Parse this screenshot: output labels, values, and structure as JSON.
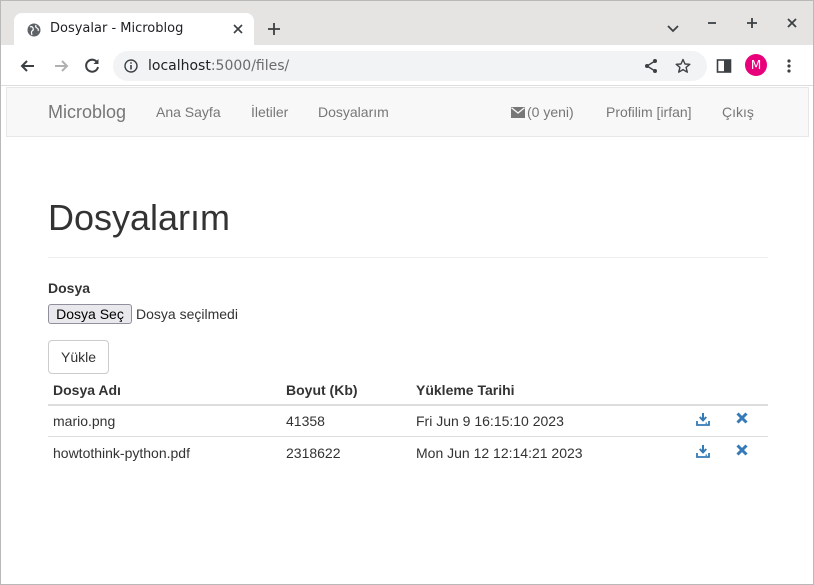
{
  "browser": {
    "tab_title": "Dosyalar - Microblog",
    "url_host": "localhost",
    "url_rest": ":5000/files/",
    "profile_initial": "M",
    "profile_color": "#e8007a"
  },
  "navbar": {
    "brand": "Microblog",
    "links": [
      "Ana Sayfa",
      "İletiler",
      "Dosyalarım"
    ],
    "messages": "(0 yeni)",
    "profile": "Profilim [irfan]",
    "logout": "Çıkış"
  },
  "page": {
    "title": "Dosyalarım",
    "file_label": "Dosya",
    "choose_button": "Dosya Seç",
    "no_file": "Dosya seçilmedi",
    "upload_button": "Yükle"
  },
  "table": {
    "headers": [
      "Dosya Adı",
      "Boyut (Kb)",
      "Yükleme Tarihi"
    ],
    "rows": [
      {
        "name": "mario.png",
        "size": "41358",
        "date": "Fri Jun 9 16:15:10 2023"
      },
      {
        "name": "howtothink-python.pdf",
        "size": "2318622",
        "date": "Mon Jun 12 12:14:21 2023"
      }
    ],
    "icons": {
      "download": "download-icon",
      "delete": "remove-icon"
    },
    "icon_color": "#337ab7"
  }
}
